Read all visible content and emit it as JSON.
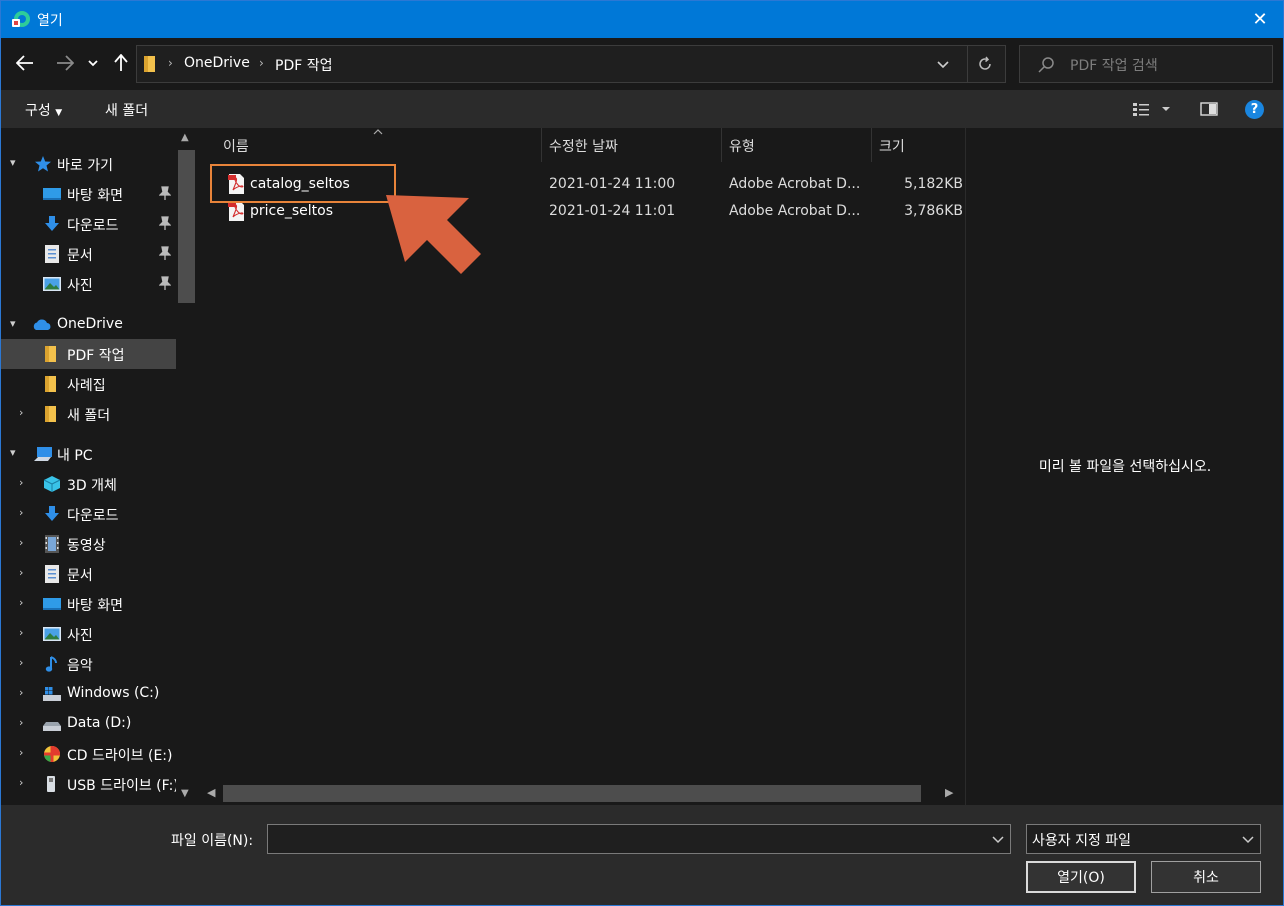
{
  "window": {
    "title": "열기",
    "close_glyph": "✕"
  },
  "address": {
    "crumbs": [
      "OneDrive",
      "PDF 작업"
    ],
    "search_placeholder": "PDF 작업 검색"
  },
  "toolbar": {
    "organize_label": "구성",
    "new_folder_label": "새 폴더",
    "help_glyph": "?"
  },
  "sidebar": {
    "items": [
      {
        "label": "바로 가기",
        "icon": "star-icon"
      },
      {
        "label": "바탕 화면",
        "icon": "desktop-icon",
        "pinned": true
      },
      {
        "label": "다운로드",
        "icon": "download-icon",
        "pinned": true
      },
      {
        "label": "문서",
        "icon": "document-icon",
        "pinned": true
      },
      {
        "label": "사진",
        "icon": "pictures-icon",
        "pinned": true
      },
      {
        "label": "OneDrive",
        "icon": "cloud-icon"
      },
      {
        "label": "PDF 작업",
        "icon": "folder-icon",
        "selected": true
      },
      {
        "label": "사례집",
        "icon": "folder-icon"
      },
      {
        "label": "새 폴더",
        "icon": "folder-icon"
      },
      {
        "label": "내 PC",
        "icon": "pc-icon"
      },
      {
        "label": "3D 개체",
        "icon": "3d-objects-icon"
      },
      {
        "label": "다운로드",
        "icon": "download-icon"
      },
      {
        "label": "동영상",
        "icon": "video-icon"
      },
      {
        "label": "문서",
        "icon": "document-icon"
      },
      {
        "label": "바탕 화면",
        "icon": "desktop-icon"
      },
      {
        "label": "사진",
        "icon": "pictures-icon"
      },
      {
        "label": "음악",
        "icon": "music-icon"
      },
      {
        "label": "Windows (C:)",
        "icon": "drive-c-icon"
      },
      {
        "label": "Data (D:)",
        "icon": "drive-icon"
      },
      {
        "label": "CD 드라이브 (E:)",
        "icon": "cd-drive-icon"
      },
      {
        "label": "USB 드라이브 (F:)",
        "icon": "usb-drive-icon"
      }
    ]
  },
  "filelist": {
    "columns": [
      "이름",
      "수정한 날짜",
      "유형",
      "크기"
    ],
    "rows": [
      {
        "name": "catalog_seltos",
        "date": "2021-01-24 11:00",
        "type": "Adobe Acrobat D...",
        "size": "5,182KB"
      },
      {
        "name": "price_seltos",
        "date": "2021-01-24 11:01",
        "type": "Adobe Acrobat D...",
        "size": "3,786KB"
      }
    ]
  },
  "preview": {
    "message": "미리 볼 파일을 선택하십시오."
  },
  "bottom": {
    "filename_label": "파일 이름(N):",
    "filename_value": "",
    "filetype_value": "사용자 지정 파일",
    "open_label": "열기(O)",
    "cancel_label": "취소"
  },
  "colors": {
    "accent": "#0078d7",
    "highlight": "#e8843a",
    "arrow": "#d9623f"
  }
}
